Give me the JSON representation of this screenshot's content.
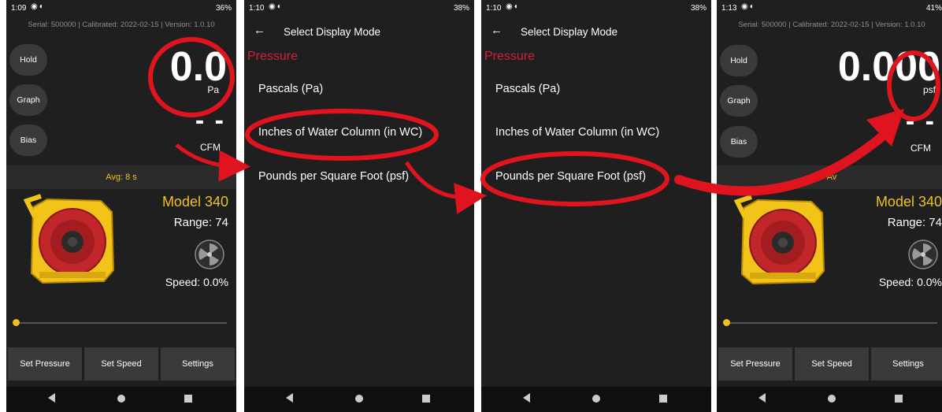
{
  "colors": {
    "accent_yellow": "#f0c020",
    "annotation_red": "#e0141e",
    "section_red": "#d0203a",
    "screen_bg": "#1f1f1f",
    "button_bg": "#3a3a3a"
  },
  "screens": [
    {
      "status": {
        "time": "1:09",
        "battery": "36%"
      },
      "serial_line": "Serial: 500000 | Calibrated: 2022-02-15 | Version: 1.0.10",
      "side_buttons": [
        "Hold",
        "Graph",
        "Bias"
      ],
      "reading": "0.0",
      "unit": "Pa",
      "flow_value": "- -",
      "flow_unit": "CFM",
      "avg_label": "Avg: 8 s",
      "model": "Model 340",
      "range": "Range: 74",
      "speed": "Speed: 0.0%",
      "bottom_buttons": [
        "Set Pressure",
        "Set Speed",
        "Settings"
      ]
    },
    {
      "status": {
        "time": "1:10",
        "battery": "38%"
      },
      "title": "Select Display Mode",
      "section": "Pressure",
      "options": [
        "Pascals (Pa)",
        "Inches of Water Column (in WC)",
        "Pounds per Square Foot (psf)"
      ]
    },
    {
      "status": {
        "time": "1:10",
        "battery": "38%"
      },
      "title": "Select Display Mode",
      "section": "Pressure",
      "options": [
        "Pascals (Pa)",
        "Inches of Water Column (in WC)",
        "Pounds per Square Foot (psf)"
      ]
    },
    {
      "status": {
        "time": "1:13",
        "battery": "41%"
      },
      "serial_line": "Serial: 500000 | Calibrated: 2022-02-15 | Version: 1.0.10",
      "side_buttons": [
        "Hold",
        "Graph",
        "Bias"
      ],
      "reading": "0.000",
      "unit": "psf",
      "flow_value": "- -",
      "flow_unit": "CFM",
      "avg_label": "Av",
      "model": "Model 340",
      "range": "Range: 74",
      "speed": "Speed: 0.0%",
      "bottom_buttons": [
        "Set Pressure",
        "Set Speed",
        "Settings"
      ]
    }
  ],
  "icons": {
    "notification": "notification-icons",
    "back": "back-arrow-icon",
    "fan": "fan-icon",
    "nav_back": "nav-back-icon",
    "nav_home": "nav-home-icon",
    "nav_recent": "nav-recent-icon"
  }
}
